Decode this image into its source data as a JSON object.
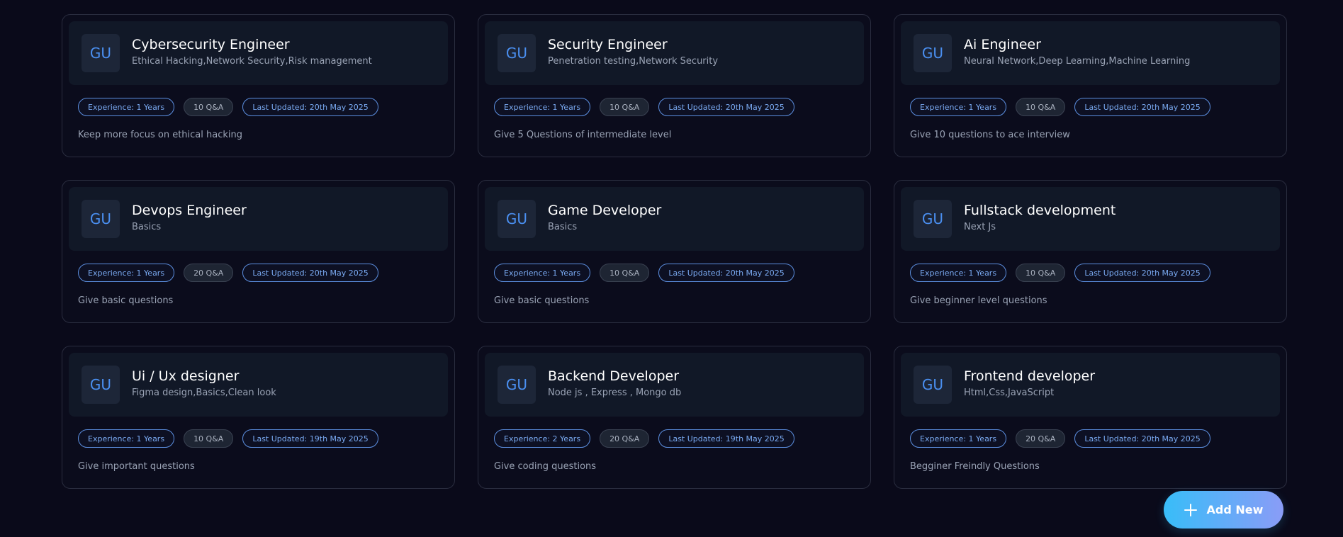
{
  "cards": [
    {
      "initials": "GU",
      "title": "Cybersecurity Engineer",
      "topics": "Ethical Hacking,Network Security,Risk management",
      "experience": "Experience: 1 Years",
      "qa": "10 Q&A",
      "updated": "Last Updated: 20th May 2025",
      "description": "Keep more focus on ethical hacking"
    },
    {
      "initials": "GU",
      "title": "Security Engineer",
      "topics": "Penetration testing,Network Security",
      "experience": "Experience: 1 Years",
      "qa": "10 Q&A",
      "updated": "Last Updated: 20th May 2025",
      "description": "Give 5 Questions of intermediate level"
    },
    {
      "initials": "GU",
      "title": "Ai Engineer",
      "topics": "Neural Network,Deep Learning,Machine Learning",
      "experience": "Experience: 1 Years",
      "qa": "10 Q&A",
      "updated": "Last Updated: 20th May 2025",
      "description": "Give 10 questions to ace interview"
    },
    {
      "initials": "GU",
      "title": "Devops Engineer",
      "topics": "Basics",
      "experience": "Experience: 1 Years",
      "qa": "20 Q&A",
      "updated": "Last Updated: 20th May 2025",
      "description": "Give basic questions"
    },
    {
      "initials": "GU",
      "title": "Game Developer",
      "topics": "Basics",
      "experience": "Experience: 1 Years",
      "qa": "10 Q&A",
      "updated": "Last Updated: 20th May 2025",
      "description": "Give basic questions"
    },
    {
      "initials": "GU",
      "title": "Fullstack development",
      "topics": "Next Js",
      "experience": "Experience: 1 Years",
      "qa": "10 Q&A",
      "updated": "Last Updated: 20th May 2025",
      "description": "Give beginner level questions"
    },
    {
      "initials": "GU",
      "title": "Ui / Ux designer",
      "topics": "Figma design,Basics,Clean look",
      "experience": "Experience: 1 Years",
      "qa": "10 Q&A",
      "updated": "Last Updated: 19th May 2025",
      "description": "Give important questions"
    },
    {
      "initials": "GU",
      "title": "Backend Developer",
      "topics": "Node js , Express , Mongo db",
      "experience": "Experience: 2 Years",
      "qa": "20 Q&A",
      "updated": "Last Updated: 19th May 2025",
      "description": "Give coding questions"
    },
    {
      "initials": "GU",
      "title": "Frontend developer",
      "topics": "Html,Css,JavaScript",
      "experience": "Experience: 1 Years",
      "qa": "20 Q&A",
      "updated": "Last Updated: 20th May 2025",
      "description": "Begginer Freindly Questions"
    }
  ],
  "add_button": {
    "label": "Add New",
    "icon": "plus-icon"
  },
  "colors": {
    "background": "#0a0a1a",
    "card_header": "#111827",
    "accent_blue": "#7aaaf2",
    "button_gradient_start": "#38bdf8",
    "button_gradient_end": "#8a9cf7"
  }
}
